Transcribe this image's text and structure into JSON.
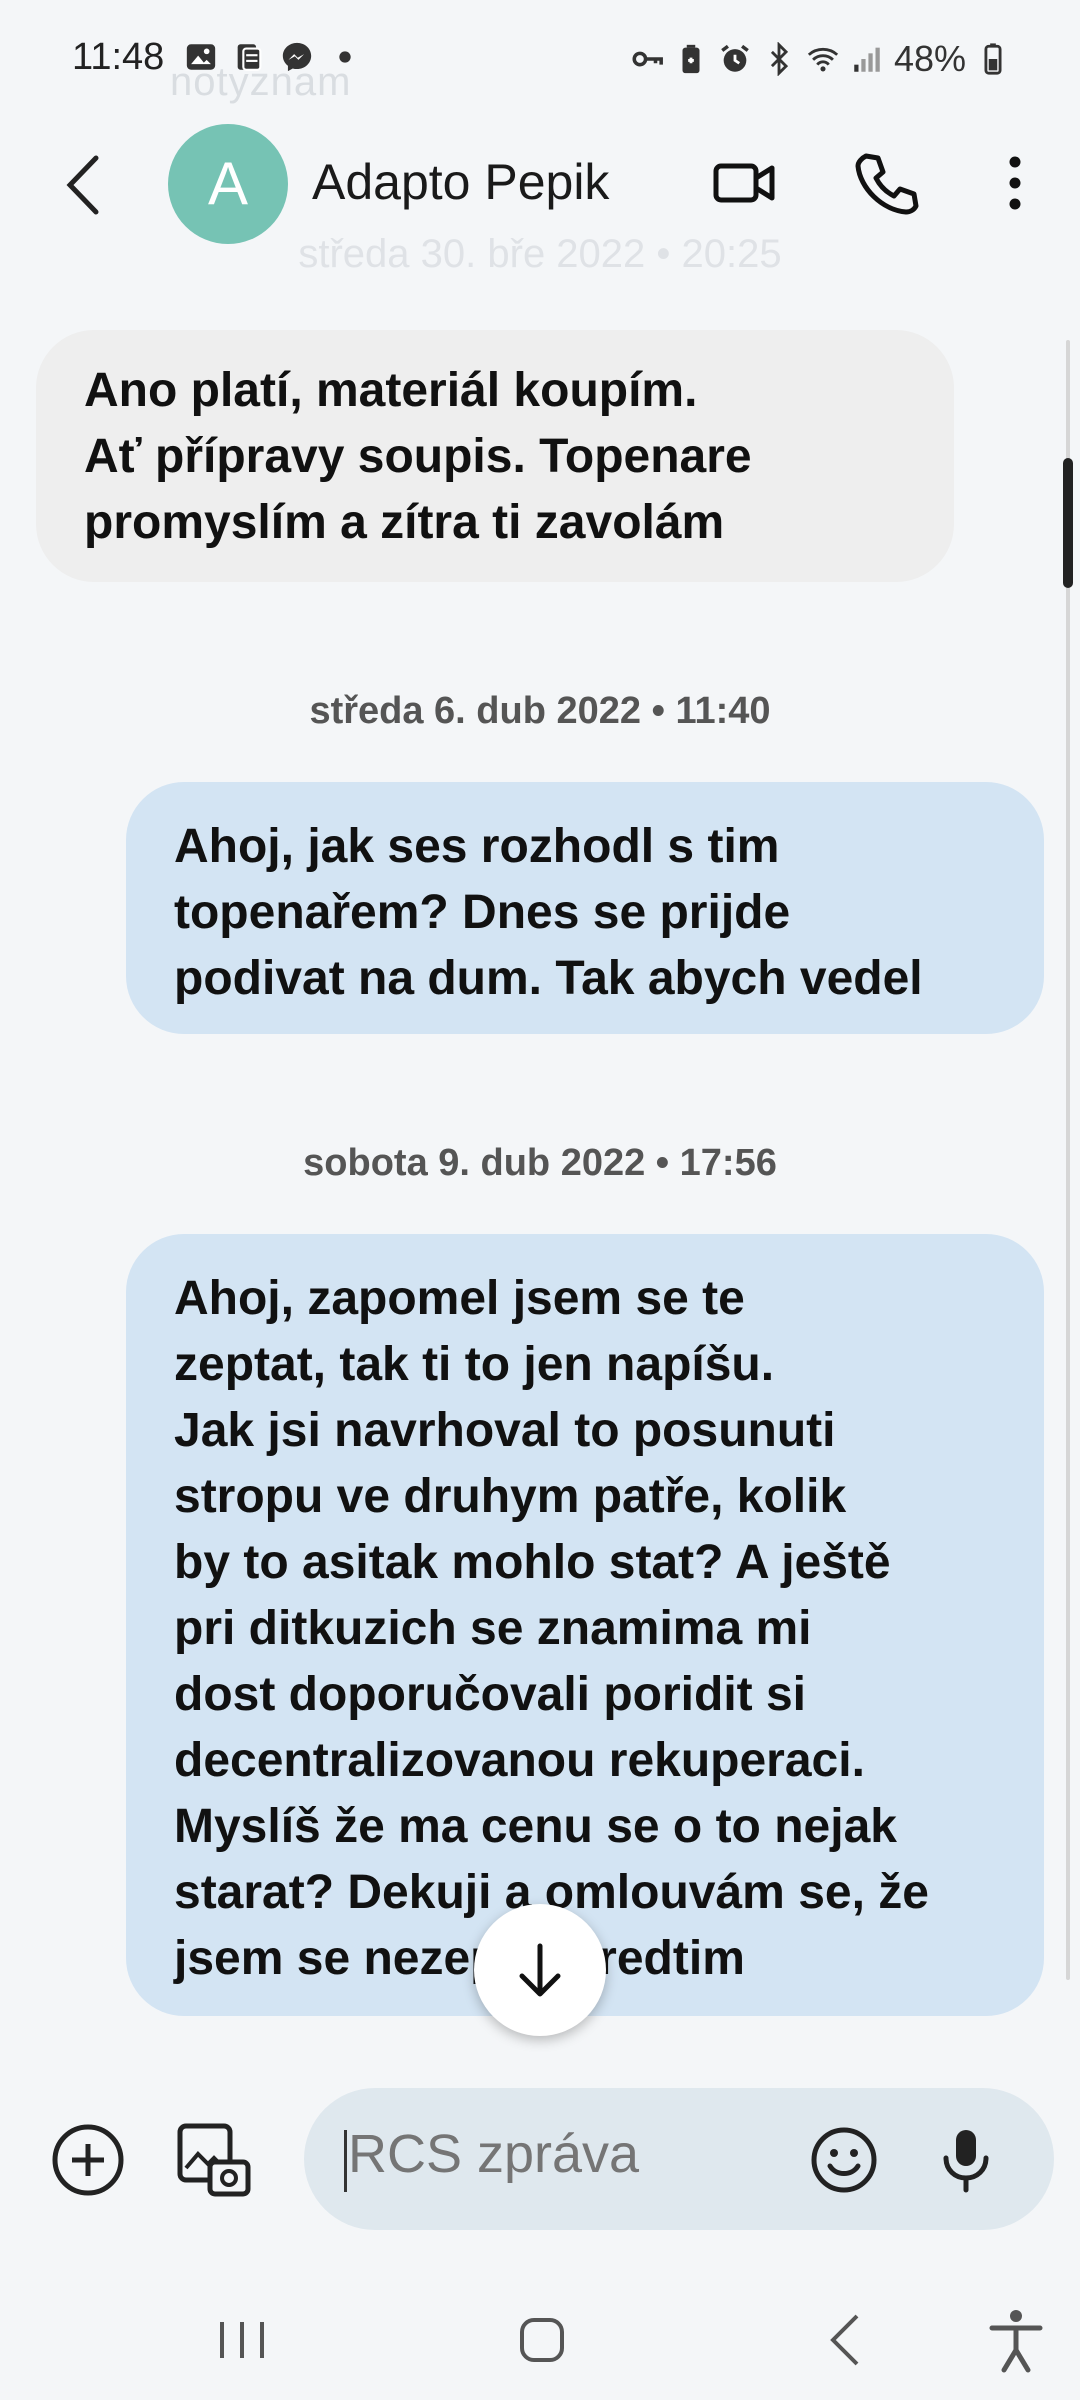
{
  "status": {
    "time": "11:48",
    "battery": "48%",
    "left_icons": [
      "gallery-icon",
      "clipboard-icon",
      "messenger-icon",
      "dot-icon"
    ],
    "right_icons": [
      "vpn-key-icon",
      "battery-saver-icon",
      "alarm-icon",
      "bluetooth-icon",
      "wifi-icon",
      "signal-icon",
      "battery-icon"
    ]
  },
  "background": {
    "faded_top": "notyznam",
    "faded_date": "středa 30. bře 2022 • 20:25"
  },
  "header": {
    "avatar_letter": "A",
    "contact_name": "Adapto Pepik"
  },
  "messages": [
    {
      "direction": "incoming",
      "text": "Ano platí, materiál koupím.\nAť přípravy soupis. Topenare\npromyslím a zítra ti zavolám"
    },
    {
      "date": "středa 6. dub 2022 • 11:40",
      "direction": "outgoing",
      "text": "Ahoj, jak ses rozhodl s tim\ntopenařem? Dnes se prijde\npodivat na dum. Tak abych vedel"
    },
    {
      "date": "sobota 9. dub 2022 • 17:56",
      "direction": "outgoing",
      "text": "Ahoj, zapomel jsem se te\nzeptat, tak ti to jen napíšu.\nJak jsi navrhoval to posunuti\nstropu ve druhym patře, kolik\nby to asitak mohlo stat? A ještě\npri ditkuzich se znamima mi\ndost doporučovali poridit si\ndecentralizovanou rekuperaci.\nMyslíš že ma cenu se o to nejak\nstarat? Dekuji a omlouvám se, že\njsem se nezeptal predtim"
    }
  ],
  "composer": {
    "placeholder": "RCS zpráva"
  },
  "colors": {
    "incoming_bubble": "#eeeeee",
    "outgoing_bubble": "#d3e4f3",
    "avatar": "#76c3b4",
    "input_pill": "#dfe8ee"
  }
}
